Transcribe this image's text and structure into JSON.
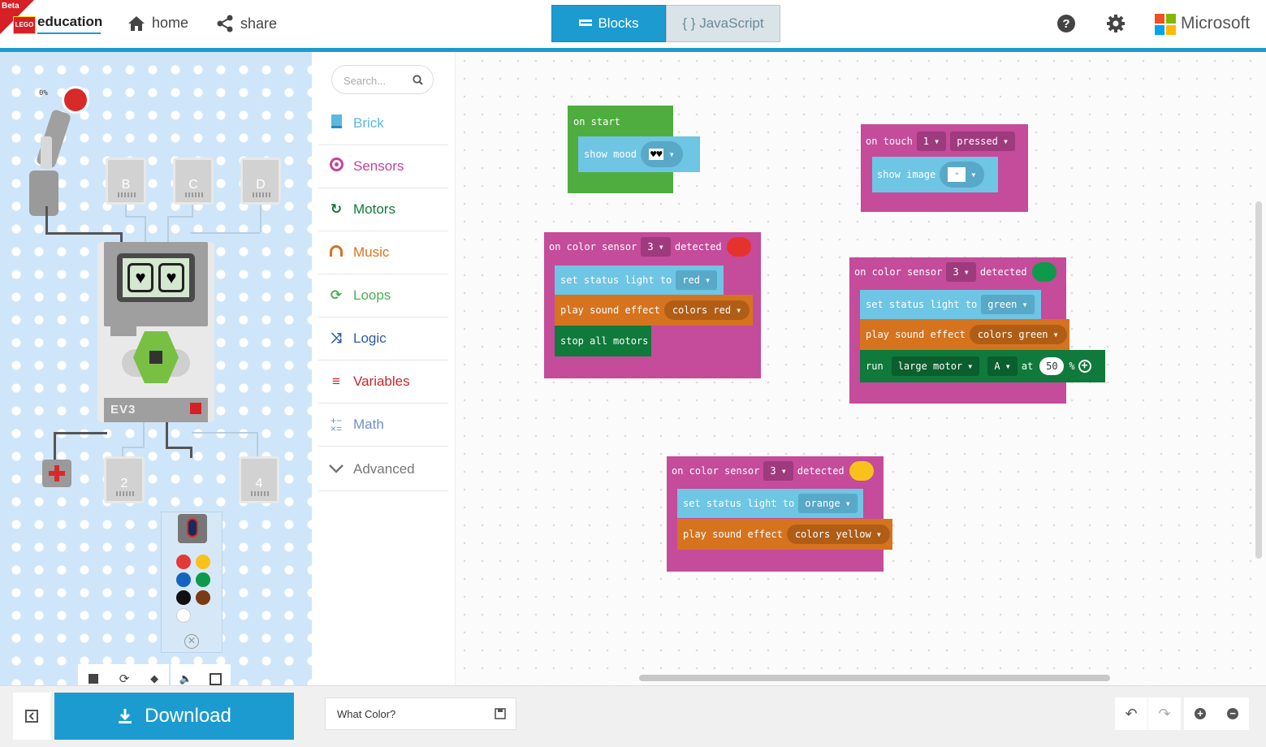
{
  "header": {
    "beta": "Beta",
    "lego_logo": "LEGO",
    "brand": "education",
    "home_label": "home",
    "share_label": "share",
    "tabs": [
      {
        "label": "Blocks",
        "active": true
      },
      {
        "label": "{ } JavaScript",
        "active": false
      }
    ],
    "microsoft_label": "Microsoft"
  },
  "simulator": {
    "motor_percent": "0%",
    "ports_top": [
      "B",
      "C",
      "D"
    ],
    "ports_bottom": [
      "2",
      "4"
    ],
    "brick_label": "EV3",
    "screen_eyes": [
      "♥",
      "♥"
    ],
    "color_sensor_colors": [
      "#e53935",
      "#f9c21b",
      "#1565c0",
      "#0d9a4b",
      "#111111",
      "#7a3a12",
      "#ffffff"
    ],
    "tools": [
      "stop-icon",
      "restart-icon",
      "slow-motion-icon",
      "mute-icon",
      "fullscreen-icon"
    ]
  },
  "toolbox": {
    "search_placeholder": "Search...",
    "categories": [
      {
        "label": "Brick",
        "color": "#5bb8e3",
        "icon": "brick-icon"
      },
      {
        "label": "Sensors",
        "color": "#c3449b",
        "icon": "sensor-icon"
      },
      {
        "label": "Motors",
        "color": "#0f7a3b",
        "icon": "motor-icon"
      },
      {
        "label": "Music",
        "color": "#d5731f",
        "icon": "headphones-icon"
      },
      {
        "label": "Loops",
        "color": "#4caf50",
        "icon": "loop-icon"
      },
      {
        "label": "Logic",
        "color": "#2e5aa8",
        "icon": "shuffle-icon"
      },
      {
        "label": "Variables",
        "color": "#c62828",
        "icon": "list-icon"
      },
      {
        "label": "Math",
        "color": "#6d8fc6",
        "icon": "calculator-icon"
      },
      {
        "label": "Advanced",
        "color": "#777777",
        "icon": "chevron-down-icon"
      }
    ]
  },
  "blocks": {
    "on_start": {
      "label": "on start",
      "show_mood": "show mood",
      "mood_value": "♥♥"
    },
    "on_touch": {
      "label": "on touch",
      "port": "1",
      "state": "pressed",
      "show_image": "show image"
    },
    "red": {
      "event": "on color sensor",
      "port": "3",
      "detected": "detected",
      "color": "#e5322d",
      "set_light": "set status light to",
      "light": "red",
      "play_sound": "play sound effect",
      "sound": "colors red",
      "stop": "stop all motors"
    },
    "green": {
      "event": "on color sensor",
      "port": "3",
      "detected": "detected",
      "color": "#0d9a4b",
      "set_light": "set status light to",
      "light": "green",
      "play_sound": "play sound effect",
      "sound": "colors green",
      "run": "run",
      "motor": "large motor",
      "motor_port": "A",
      "at": "at",
      "speed": "50",
      "pct": "%"
    },
    "yellow": {
      "event": "on color sensor",
      "port": "3",
      "detected": "detected",
      "color": "#f9c21b",
      "set_light": "set status light to",
      "light": "orange",
      "play_sound": "play sound effect",
      "sound": "colors yellow"
    }
  },
  "bottom": {
    "download_label": "Download",
    "project_name": "What Color?"
  }
}
